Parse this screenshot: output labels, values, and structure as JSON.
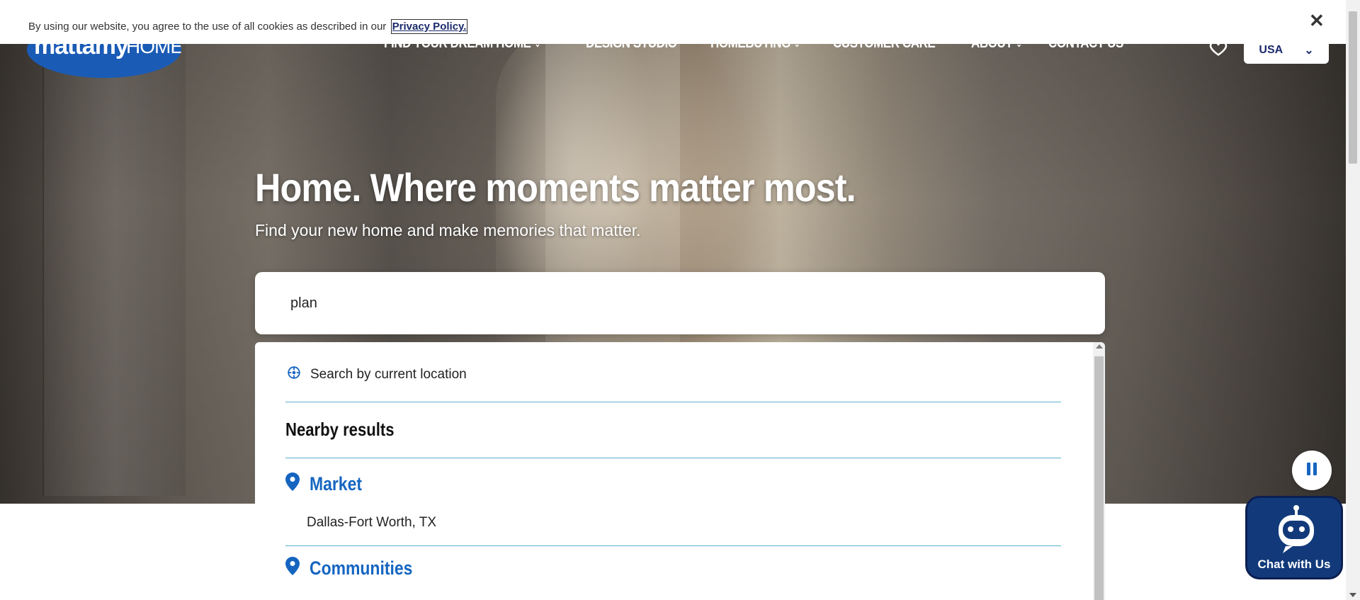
{
  "cookie_banner": {
    "text": "By using our website, you agree to the use of all cookies as described in our",
    "link_label": "Privacy Policy."
  },
  "header": {
    "logo_text_bold": "mattamy",
    "logo_text_light": "HOMES",
    "nav": [
      {
        "label": "FIND YOUR DREAM HOME",
        "has_chevron": true
      },
      {
        "label": "DESIGN STUDIO",
        "has_chevron": false
      },
      {
        "label": "HOMEBUYING",
        "has_chevron": true
      },
      {
        "label": "CUSTOMER CARE",
        "has_chevron": false
      },
      {
        "label": "ABOUT",
        "has_chevron": true
      },
      {
        "label": "CONTACT US",
        "has_chevron": false
      }
    ],
    "country_selector": "USA"
  },
  "hero": {
    "title": "Home. Where moments matter most.",
    "subtitle": "Find your new home and make memories that matter."
  },
  "search": {
    "value": "plan"
  },
  "dropdown": {
    "current_location_label": "Search by current location",
    "nearby_heading": "Nearby results",
    "categories": [
      {
        "label": "Market",
        "results": [
          "Dallas-Fort Worth, TX"
        ]
      },
      {
        "label": "Communities",
        "results": []
      }
    ]
  },
  "chat": {
    "label": "Chat with Us"
  },
  "colors": {
    "brand_blue": "#1a5bb5",
    "link_blue": "#1565c0",
    "divider_teal": "#5ab0c8",
    "chat_bg": "#123a7a"
  }
}
